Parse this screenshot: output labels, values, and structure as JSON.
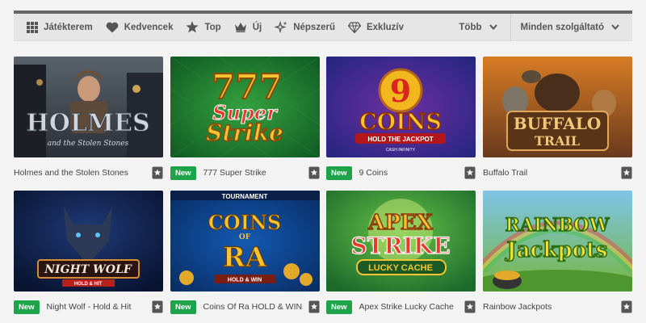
{
  "nav": {
    "items": [
      {
        "label": "Játékterem",
        "icon": "grid-icon"
      },
      {
        "label": "Kedvencek",
        "icon": "heart-icon"
      },
      {
        "label": "Top",
        "icon": "star-icon"
      },
      {
        "label": "Új",
        "icon": "crown-icon"
      },
      {
        "label": "Népszerű",
        "icon": "sparkle-icon"
      },
      {
        "label": "Exkluzív",
        "icon": "diamond-icon"
      }
    ],
    "more_label": "Több",
    "provider_label": "Minden szolgáltató"
  },
  "games": [
    {
      "title": "Holmes and the Stolen Stones",
      "is_new": false,
      "art": {
        "lines": [
          "HOLMES",
          "and the Stolen Stones"
        ],
        "colors": [
          "#2a3038",
          "#59626b"
        ]
      }
    },
    {
      "title": "777 Super Strike",
      "is_new": true,
      "art": {
        "lines": [
          "777",
          "Super",
          "Strike"
        ],
        "colors": [
          "#0f5a23",
          "#35a23f"
        ]
      }
    },
    {
      "title": "9 Coins",
      "is_new": true,
      "art": {
        "lines": [
          "9",
          "COINS",
          "HOLD THE JACKPOT",
          "CASH INFINITY"
        ],
        "colors": [
          "#24267f",
          "#6d2fa2"
        ]
      }
    },
    {
      "title": "Buffalo Trail",
      "is_new": false,
      "art": {
        "lines": [
          "BUFFALO",
          "TRAIL"
        ],
        "colors": [
          "#d77c24",
          "#6a3a1e"
        ]
      }
    },
    {
      "title": "Night Wolf - Hold & Hit",
      "is_new": true,
      "art": {
        "lines": [
          "NIGHT WOLF",
          "HOLD & HIT"
        ],
        "colors": [
          "#08132f",
          "#1f3a78"
        ]
      }
    },
    {
      "title": "Coins Of Ra HOLD & WIN",
      "is_new": true,
      "art": {
        "lines": [
          "TOURNAMENT",
          "COINS",
          "OF",
          "RA",
          "HOLD & WIN"
        ],
        "colors": [
          "#082c63",
          "#145ab3"
        ]
      }
    },
    {
      "title": "Apex Strike Lucky Cache",
      "is_new": true,
      "art": {
        "lines": [
          "APEX",
          "STRIKE",
          "LUCKY CACHE"
        ],
        "colors": [
          "#1d6a2b",
          "#66c248"
        ]
      }
    },
    {
      "title": "Rainbow Jackpots",
      "is_new": false,
      "art": {
        "lines": [
          "RAINBOW",
          "Jackpots"
        ],
        "colors": [
          "#7ec4e8",
          "#76b641"
        ]
      }
    }
  ],
  "new_badge_label": "New",
  "colors": {
    "accent_green": "#1fa34a",
    "nav_bg": "#e6e6e6",
    "page_bg": "#f3f3f3"
  }
}
